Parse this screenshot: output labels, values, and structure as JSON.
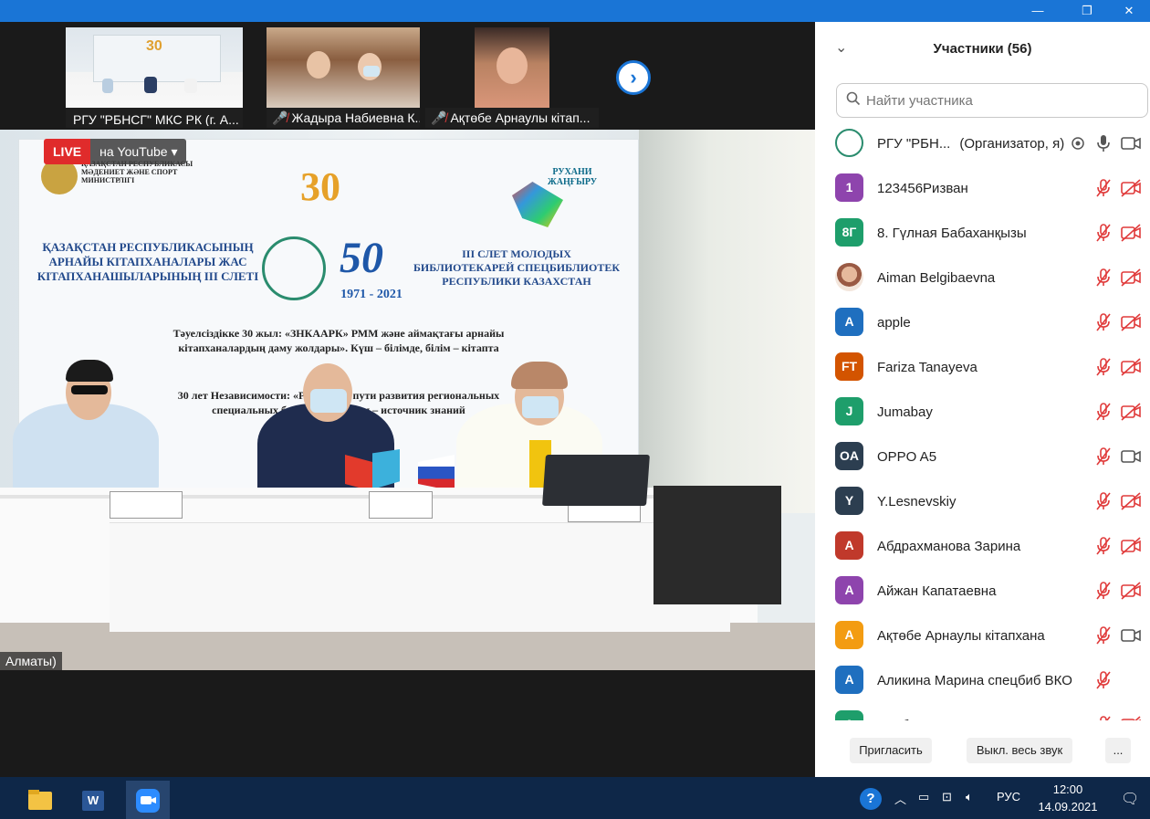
{
  "window": {
    "minimize_glyph": "—",
    "maximize_glyph": "❐",
    "close_glyph": "✕"
  },
  "thumbnails": [
    {
      "name": "РГУ \"РБНСГ\" МКС РК (г. А...",
      "muted": false
    },
    {
      "name": "Жадыра Набиевна К...",
      "muted": true
    },
    {
      "name": "Ақтөбе Арнаулы кітап...",
      "muted": true
    }
  ],
  "main_video": {
    "live_label": "LIVE",
    "stream_label": "на YouTube",
    "city_tag": "Алматы)",
    "banner": {
      "ministry": "ҚАЗАҚСТАН РЕСПУБЛИКАСЫ МӘДЕНИЕТ ЖӘНЕ СПОРТ МИНИСТРЛІГІ",
      "kz_title": "ҚАЗАҚСТАН РЕСПУБЛИКАСЫНЫҢ АРНАЙЫ КІТАПХАНАЛАРЫ ЖАС КІТАПХАНАШЫЛАРЫНЫҢ ІІІ СЛЕТІ",
      "anniv_30": "30",
      "anniv_50": "50",
      "anniv_years": "1971 - 2021",
      "ru_title": "III СЛЕТ МОЛОДЫХ БИБЛИОТЕКАРЕЙ СПЕЦБИБЛИОТЕК РЕСПУБЛИКИ КАЗАХСТАН",
      "rukhani": "РУХАНИ ЖАҢҒЫРУ",
      "kz_sub": "Тәуелсіздікке 30 жыл: «ЗНКААРК» РММ және аймақтағы арнайы кітапханалардың даму жолдары». Күш – білімде, білім – кітапта",
      "ru_sub": "30 лет Независимости: «РБНСГ» и пути развития региональных специальных библиотек. Книги – источник знаний"
    }
  },
  "participants": {
    "title": "Участники (56)",
    "search_placeholder": "Найти участника",
    "items": [
      {
        "initials": "",
        "name": "РГУ \"РБН...",
        "role": "(Организатор, я)",
        "color": "#ffffff",
        "host": true
      },
      {
        "initials": "1",
        "name": "123456Ризван",
        "role": "",
        "color": "#8e44ad",
        "video_off": true
      },
      {
        "initials": "8Г",
        "name": "8. Гүлная Бабаханқызы",
        "role": "",
        "color": "#1e9e6b",
        "video_off": true
      },
      {
        "initials": "",
        "name": "Aiman Belgibaevna",
        "role": "",
        "color": "#d9a58a",
        "photo": true,
        "video_off": true
      },
      {
        "initials": "A",
        "name": "apple",
        "role": "",
        "color": "#1f6fbf",
        "video_off": true
      },
      {
        "initials": "FT",
        "name": "Fariza Tanayeva",
        "role": "",
        "color": "#d35400",
        "video_off": true
      },
      {
        "initials": "J",
        "name": "Jumabay",
        "role": "",
        "color": "#1e9e6b",
        "video_off": true
      },
      {
        "initials": "OA",
        "name": "OPPO A5",
        "role": "",
        "color": "#2c3e50",
        "video_off": false
      },
      {
        "initials": "Y",
        "name": "Y.Lesnevskiy",
        "role": "",
        "color": "#2c3e50",
        "video_off": true
      },
      {
        "initials": "А",
        "name": "Абдрахманова Зарина",
        "role": "",
        "color": "#c0392b",
        "video_off": true
      },
      {
        "initials": "А",
        "name": "Айжан Капатаевна",
        "role": "",
        "color": "#8e44ad",
        "video_off": true
      },
      {
        "initials": "А",
        "name": "Ақтөбе Арнаулы кітапхана",
        "role": "",
        "color": "#f39c12",
        "video_off": false
      },
      {
        "initials": "А",
        "name": "Аликина Марина спецбиб ВКО",
        "role": "",
        "color": "#1f6fbf",
        "video_off": null
      },
      {
        "initials": "А",
        "name": "Альбина Жан...",
        "role": "",
        "color": "#1e9e6b",
        "video_off": true
      }
    ],
    "invite_label": "Пригласить",
    "mute_all_label": "Выкл. весь звук",
    "more_label": "..."
  },
  "taskbar": {
    "language": "РУС",
    "time": "12:00",
    "date": "14.09.2021"
  }
}
